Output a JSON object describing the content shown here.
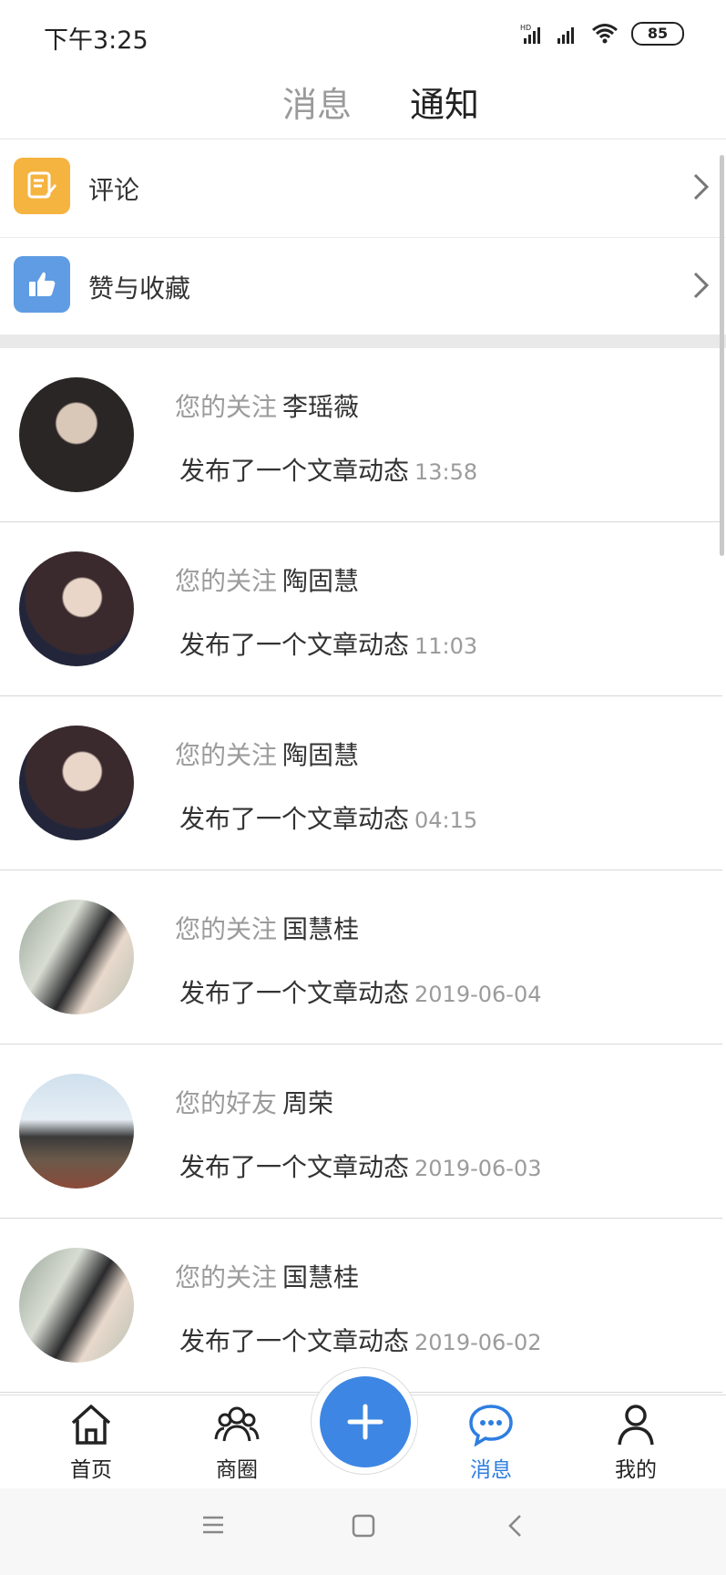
{
  "status_bar": {
    "time": "下午3:25",
    "hd": "HD",
    "battery": "85"
  },
  "top_tabs": {
    "messages": "消息",
    "notices": "通知"
  },
  "menu": [
    {
      "label": "评论",
      "icon": "comment-icon",
      "color": "#f5b340"
    },
    {
      "label": "赞与收藏",
      "icon": "thumbs-up-icon",
      "color": "#5f9ce3"
    }
  ],
  "feed": [
    {
      "relation": "您的关注",
      "name": "李瑶薇",
      "action": "发布了一个文章动态",
      "time": "13:58"
    },
    {
      "relation": "您的关注",
      "name": "陶固慧",
      "action": "发布了一个文章动态",
      "time": "11:03"
    },
    {
      "relation": "您的关注",
      "name": "陶固慧",
      "action": "发布了一个文章动态",
      "time": "04:15"
    },
    {
      "relation": "您的关注",
      "name": "国慧桂",
      "action": "发布了一个文章动态",
      "time": "2019-06-04"
    },
    {
      "relation": "您的好友",
      "name": "周荣",
      "action": "发布了一个文章动态",
      "time": "2019-06-03"
    },
    {
      "relation": "您的关注",
      "name": "国慧桂",
      "action": "发布了一个文章动态",
      "time": "2019-06-02"
    }
  ],
  "bottom_nav": {
    "home": "首页",
    "circle": "商圈",
    "messages": "消息",
    "me": "我的",
    "active_color": "#2e7ee0"
  },
  "fab": {
    "icon": "plus-icon",
    "color": "#3d86e3"
  }
}
